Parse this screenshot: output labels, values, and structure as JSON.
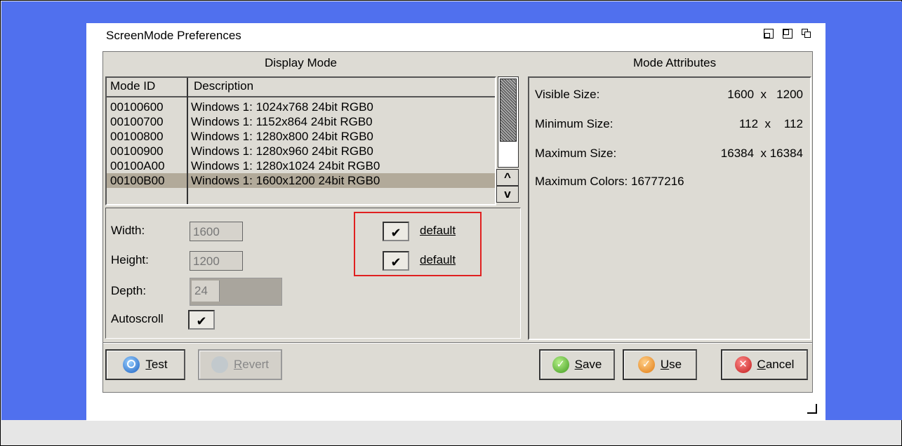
{
  "window": {
    "title": "ScreenMode Preferences"
  },
  "display_mode": {
    "heading": "Display Mode",
    "columns": {
      "id": "Mode ID",
      "description": "Description"
    },
    "rows": [
      {
        "id": "00100600",
        "description": "Windows 1: 1024x768 24bit RGB0"
      },
      {
        "id": "00100700",
        "description": "Windows 1: 1152x864 24bit RGB0"
      },
      {
        "id": "00100800",
        "description": "Windows 1: 1280x800 24bit RGB0"
      },
      {
        "id": "00100900",
        "description": "Windows 1: 1280x960 24bit RGB0"
      },
      {
        "id": "00100A00",
        "description": "Windows 1: 1280x1024 24bit RGB0"
      },
      {
        "id": "00100B00",
        "description": "Windows 1: 1600x1200 24bit RGB0"
      }
    ],
    "selected_index": 5,
    "scroll_up": "^",
    "scroll_down": "v"
  },
  "settings": {
    "width_label": "Width:",
    "width_value": "1600",
    "height_label": "Height:",
    "height_value": "1200",
    "depth_label": "Depth:",
    "depth_value": "24",
    "autoscroll_label": "Autoscroll",
    "autoscroll_check": "✔",
    "width_default_check": "✔",
    "width_default_label": "default",
    "height_default_check": "✔",
    "height_default_label": "default"
  },
  "mode_attributes": {
    "heading": "Mode Attributes",
    "visible_label": "Visible Size:",
    "visible_value": "1600  x   1200",
    "minimum_label": "Minimum Size:",
    "minimum_value": "112  x    112",
    "maximum_label": "Maximum Size:",
    "maximum_value": "16384  x 16384",
    "colors_label": "Maximum Colors:",
    "colors_value": "16777216"
  },
  "buttons": {
    "test": {
      "underline": "T",
      "rest": "est"
    },
    "revert": {
      "underline": "R",
      "rest": "evert"
    },
    "save": {
      "underline": "S",
      "rest": "ave"
    },
    "use": {
      "underline": "U",
      "rest": "se"
    },
    "cancel": {
      "underline": "C",
      "rest": "ancel"
    }
  }
}
